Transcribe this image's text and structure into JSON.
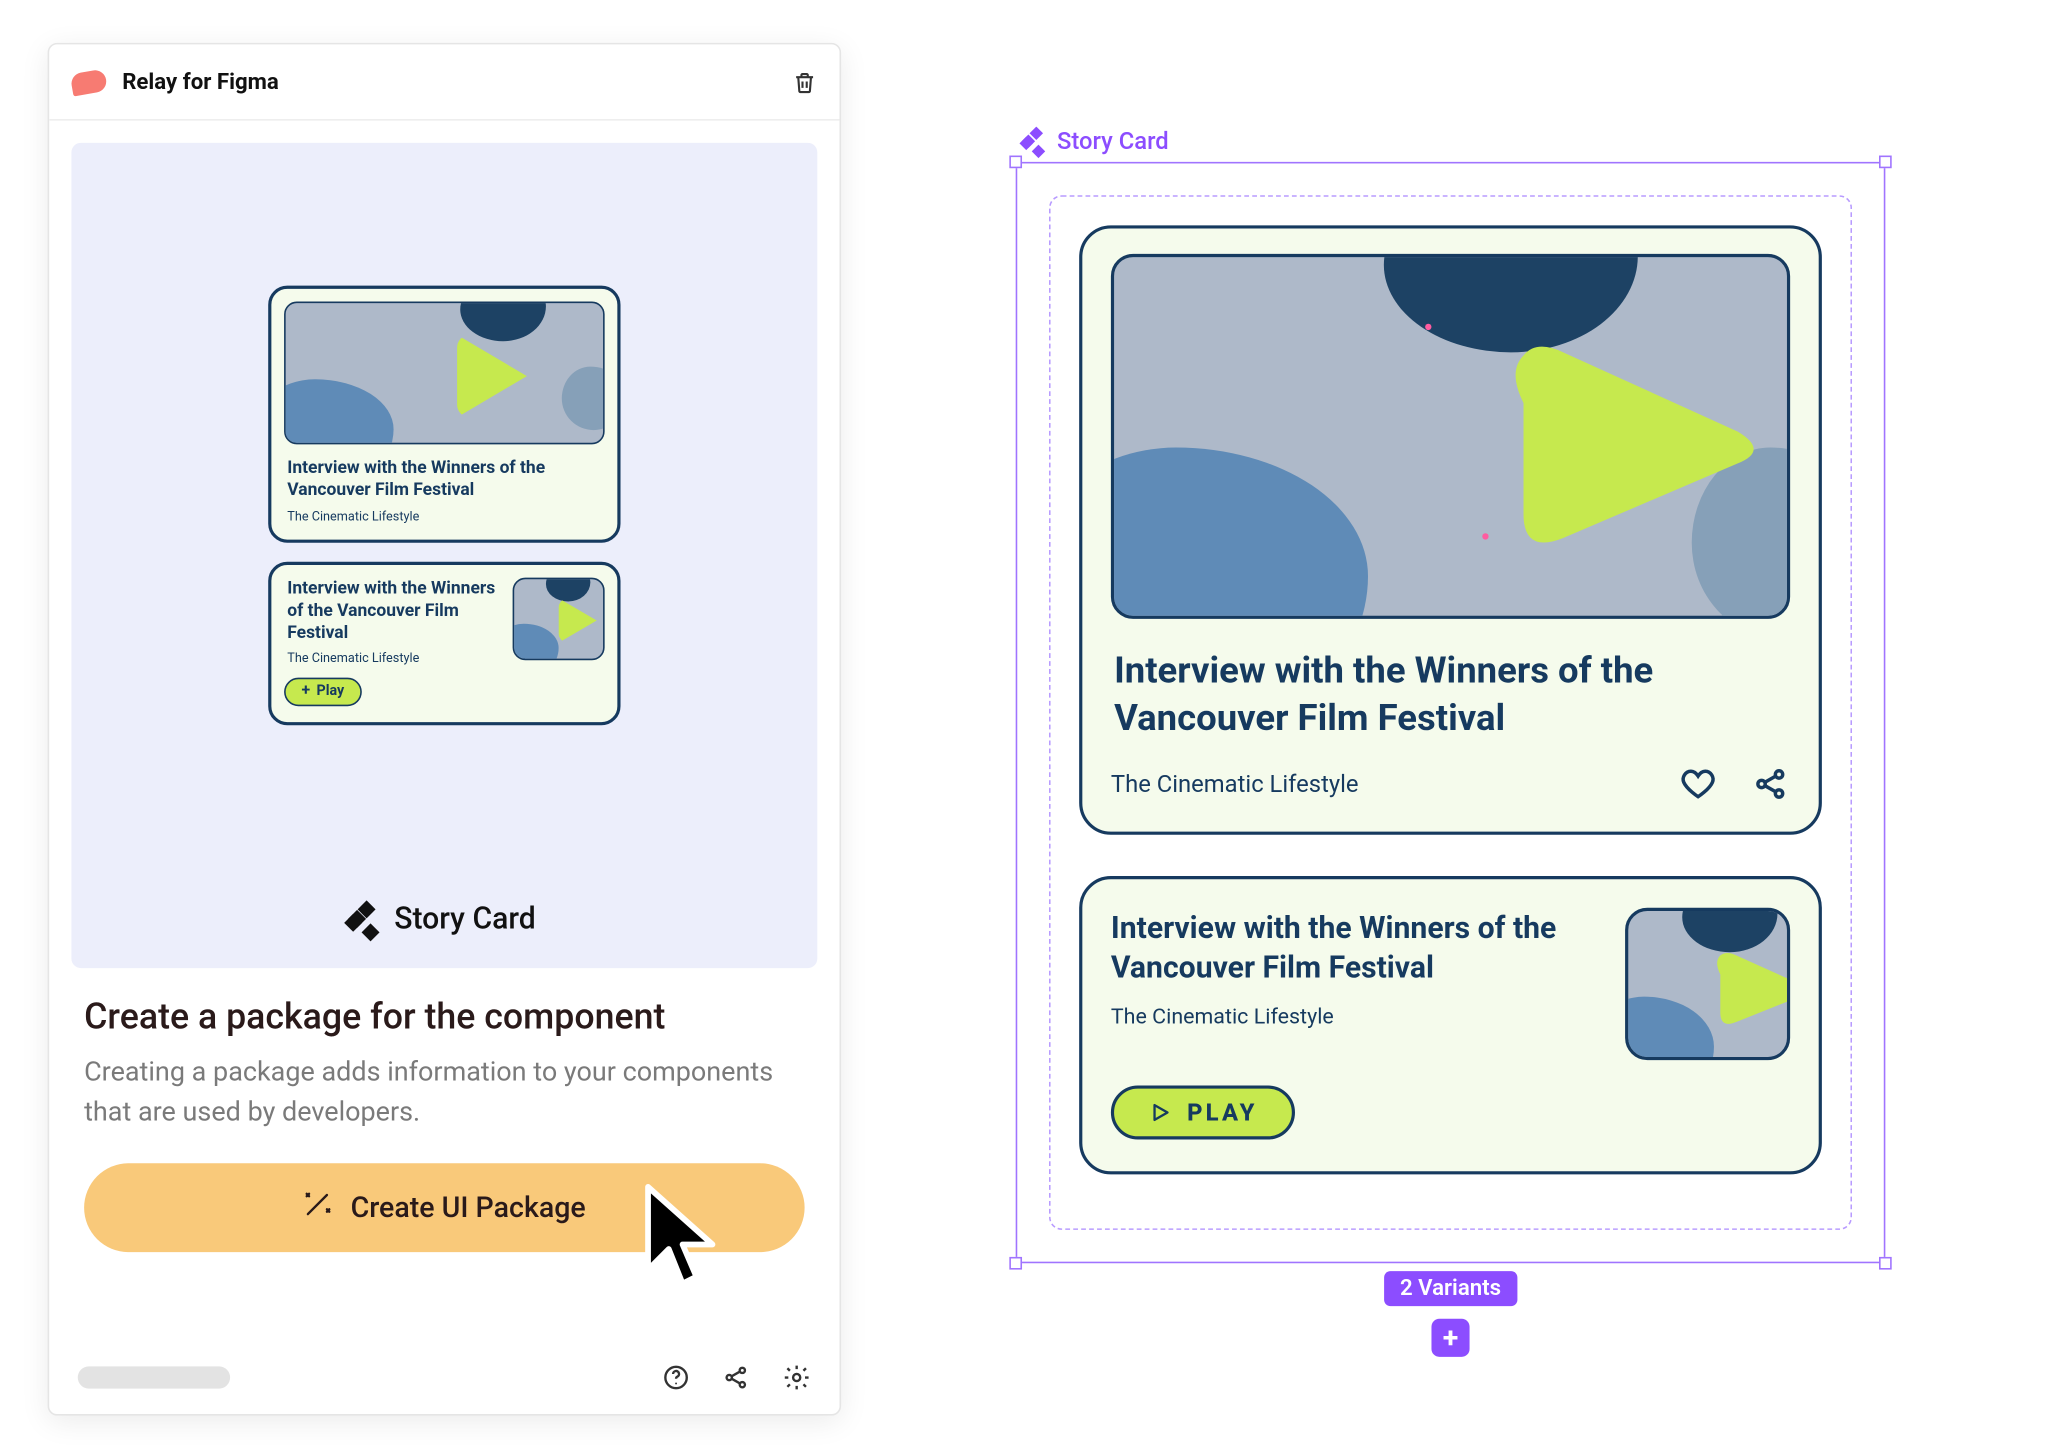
{
  "plugin": {
    "title": "Relay for Figma",
    "component_label": "Story Card",
    "heading": "Create a package for the component",
    "description": "Creating a package adds information to your components that are used by developers.",
    "cta_label": "Create UI Package"
  },
  "preview": {
    "card1": {
      "title": "Interview with the Winners of the Vancouver Film Festival",
      "subtitle": "The Cinematic Lifestyle"
    },
    "card2": {
      "title": "Interview with the Winners of the Vancouver Film Festival",
      "subtitle": "The Cinematic Lifestyle",
      "play_label": "Play"
    }
  },
  "canvas": {
    "frame_label": "Story Card",
    "card1": {
      "title": "Interview with the Winners of the Vancouver Film Festival",
      "subtitle": "The Cinematic Lifestyle"
    },
    "card2": {
      "title": "Interview with the Winners of the Vancouver Film Festival",
      "subtitle": "The Cinematic Lifestyle",
      "play_label": "PLAY"
    },
    "variants_label": "2 Variants"
  },
  "icons": {
    "trash": "trash-icon",
    "help": "help-icon",
    "share": "share-icon",
    "gear": "gear-icon",
    "wand": "wand-icon",
    "heart": "heart-icon",
    "add": "add-icon"
  },
  "colors": {
    "card_bg": "#f5fbec",
    "card_border": "#163a5f",
    "accent_lime": "#c6e94e",
    "thumb_bg": "#aeb9c9",
    "figma_purple": "#8c4dff",
    "cta_bg": "#f9c97a"
  }
}
